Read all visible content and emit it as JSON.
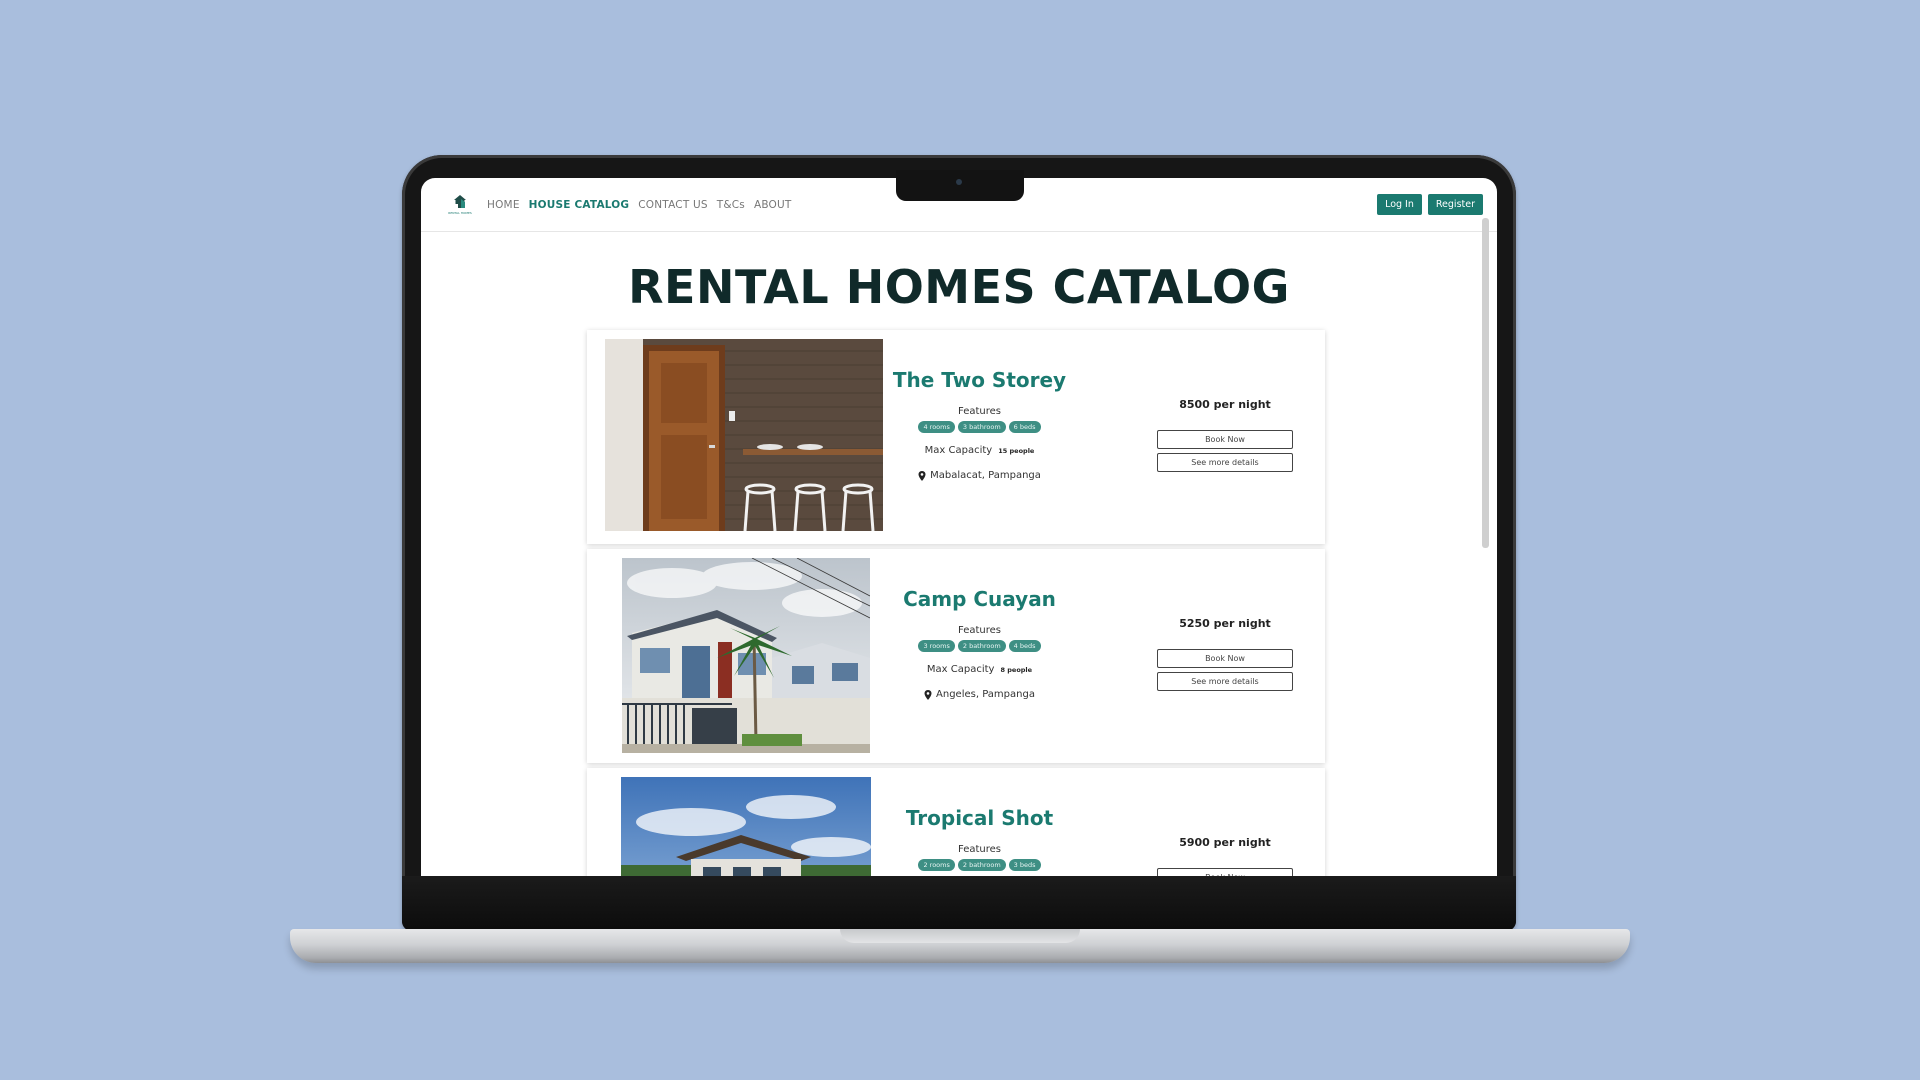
{
  "nav": {
    "logo_text": "RENTAL HOMES",
    "links": [
      "HOME",
      "HOUSE CATALOG",
      "CONTACT US",
      "T&Cs",
      "ABOUT"
    ],
    "active_index": 1,
    "login_label": "Log In",
    "register_label": "Register"
  },
  "page": {
    "title": "RENTAL HOMES CATALOG"
  },
  "listings": [
    {
      "title": "The Two Storey",
      "features_label": "Features",
      "tags": [
        "4 rooms",
        "3 bathroom",
        "6 beds"
      ],
      "capacity_label": "Max Capacity",
      "capacity_value": "15 people",
      "location": "Mabalacat, Pampanga",
      "price": "8500 per night",
      "book_label": "Book Now",
      "details_label": "See more details"
    },
    {
      "title": "Camp Cuayan",
      "features_label": "Features",
      "tags": [
        "3 rooms",
        "2 bathroom",
        "4 beds"
      ],
      "capacity_label": "Max Capacity",
      "capacity_value": "8 people",
      "location": "Angeles, Pampanga",
      "price": "5250 per night",
      "book_label": "Book Now",
      "details_label": "See more details"
    },
    {
      "title": "Tropical Shot",
      "features_label": "Features",
      "tags": [
        "2 rooms",
        "2 bathroom",
        "3 beds"
      ],
      "price": "5900 per night",
      "book_label": "Book Now"
    }
  ],
  "colors": {
    "background": "#a9bedd",
    "brand": "#1b7a70",
    "tag": "#3e8f84",
    "title": "#102a2a"
  },
  "icons": [
    "house-logo-icon",
    "location-pin-icon"
  ]
}
